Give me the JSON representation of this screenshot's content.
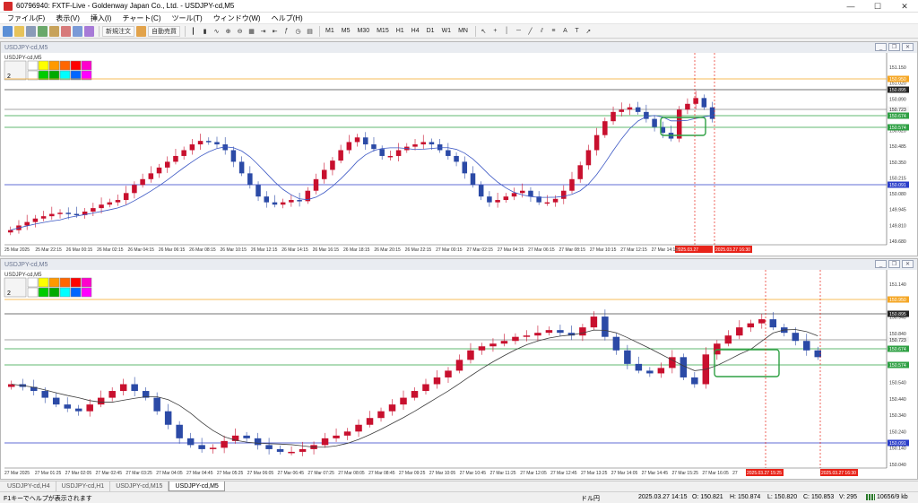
{
  "window": {
    "title": "60796940: FXTF-Live - Goldenway Japan Co., Ltd. - USDJPY-cd,M5"
  },
  "menu": [
    "ファイル(F)",
    "表示(V)",
    "挿入(I)",
    "チャート(C)",
    "ツール(T)",
    "ウィンドウ(W)",
    "ヘルプ(H)"
  ],
  "toolbar": {
    "new_order": "新規注文",
    "auto_trade": "自動売買",
    "timeframes": [
      "M1",
      "M5",
      "M30",
      "M15",
      "H1",
      "H4",
      "D1",
      "W1",
      "MN"
    ]
  },
  "colors": {
    "bull": "#c8102e",
    "bear": "#2b4aa6",
    "ma": "#3b57c4",
    "ma2": "#3c3c3c",
    "orange": "#f5a623",
    "green": "#2ea043",
    "blue_line": "#2b3ec9",
    "red_marker": "#e8241a"
  },
  "chart_top": {
    "title": "USDJPY-cd,M5",
    "subtitle": "USDJPY-cd,M5",
    "y_ticks": [
      "151.150",
      "151.020",
      "150.890",
      "150.755",
      "150.620",
      "150.485",
      "150.350",
      "150.215",
      "150.080",
      "149.945",
      "149.810",
      "149.680"
    ],
    "tags": [
      "150.950",
      "150.895",
      "150.723",
      "150.674",
      "150.574",
      "150.091"
    ],
    "x_ticks": [
      "25 Mar 2025",
      "25 Mar 22:15",
      "26 Mar 00:15",
      "26 Mar 02:15",
      "26 Mar 04:15",
      "26 Mar 06:15",
      "26 Mar 08:15",
      "26 Mar 10:15",
      "26 Mar 12:15",
      "26 Mar 14:15",
      "26 Mar 16:15",
      "26 Mar 18:15",
      "26 Mar 20:15",
      "26 Mar 22:15",
      "27 Mar 00:15",
      "27 Mar 02:15",
      "27 Mar 04:15",
      "27 Mar 06:15",
      "27 Mar 08:15",
      "27 Mar 10:15",
      "27 Mar 12:15",
      "27 Mar 14:15"
    ],
    "red_labels": [
      "2025.03.27 ",
      "2025.03.27 16:30"
    ],
    "closes": [
      149.86,
      149.9,
      149.93,
      149.96,
      149.98,
      150.0,
      150.01,
      150.0,
      149.99,
      150.02,
      150.05,
      150.08,
      150.1,
      150.12,
      150.18,
      150.25,
      150.3,
      150.35,
      150.4,
      150.45,
      150.5,
      150.55,
      150.6,
      150.63,
      150.62,
      150.6,
      150.55,
      150.45,
      150.35,
      150.25,
      150.15,
      150.1,
      150.08,
      150.1,
      150.12,
      150.11,
      150.2,
      150.3,
      150.38,
      150.46,
      150.55,
      150.62,
      150.66,
      150.6,
      150.56,
      150.5,
      150.5,
      150.55,
      150.58,
      150.6,
      150.62,
      150.6,
      150.55,
      150.5,
      150.45,
      150.35,
      150.25,
      150.15,
      150.1,
      150.12,
      150.15,
      150.18,
      150.2,
      150.15,
      150.1,
      150.1,
      150.13,
      150.2,
      150.3,
      150.42,
      150.55,
      150.68,
      150.8,
      150.88,
      150.9,
      150.92,
      150.88,
      150.82,
      150.75,
      150.7,
      150.65,
      150.9,
      150.95,
      151.0,
      150.92,
      150.82
    ]
  },
  "chart_bottom": {
    "title": "USDJPY-cd,M5",
    "subtitle": "USDJPY-cd,M5",
    "y_ticks": [
      "151.140",
      "151.040",
      "150.940",
      "150.840",
      "150.740",
      "150.640",
      "150.540",
      "150.440",
      "150.340",
      "150.240",
      "150.140",
      "150.040"
    ],
    "tags": [
      "150.950",
      "150.895",
      "150.723",
      "150.674",
      "150.574",
      "150.091"
    ],
    "x_ticks": [
      "27 Mar 2025",
      "27 Mar 01:25",
      "27 Mar 02:05",
      "27 Mar 02:45",
      "27 Mar 03:25",
      "27 Mar 04:05",
      "27 Mar 04:45",
      "27 Mar 05:25",
      "27 Mar 06:05",
      "27 Mar 06:45",
      "27 Mar 07:25",
      "27 Mar 08:05",
      "27 Mar 08:45",
      "27 Mar 09:25",
      "27 Mar 10:05",
      "27 Mar 10:45",
      "27 Mar 11:25",
      "27 Mar 12:05",
      "27 Mar 12:45",
      "27 Mar 13:25",
      "27 Mar 14:05",
      "27 Mar 14:45",
      "27 Mar 15:25",
      "27 Mar 16:05",
      "27"
    ],
    "red_labels": [
      "2025.03.27 15:25",
      "2025.03.27 16:30"
    ],
    "closes": [
      150.6,
      150.58,
      150.55,
      150.5,
      150.45,
      150.42,
      150.4,
      150.45,
      150.5,
      150.55,
      150.6,
      150.55,
      150.5,
      150.4,
      150.3,
      150.2,
      150.15,
      150.12,
      150.13,
      150.18,
      150.22,
      150.2,
      150.15,
      150.12,
      150.1,
      150.1,
      150.12,
      150.15,
      150.2,
      150.22,
      150.25,
      150.3,
      150.35,
      150.4,
      150.45,
      150.5,
      150.55,
      150.6,
      150.65,
      150.7,
      150.78,
      150.85,
      150.88,
      150.9,
      150.92,
      150.95,
      150.96,
      150.98,
      151.0,
      150.98,
      150.96,
      151.02,
      151.1,
      150.95,
      150.85,
      150.75,
      150.7,
      150.68,
      150.72,
      150.8,
      150.65,
      150.6,
      150.82,
      150.9,
      150.96,
      151.02,
      151.05,
      151.08,
      151.02,
      150.98,
      150.92,
      150.85,
      150.8
    ]
  },
  "tabs": [
    "USDJPY-cd,H4",
    "USDJPY-cd,H1",
    "USDJPY-cd,M15",
    "USDJPY-cd,M5"
  ],
  "status": {
    "help": "F1キーでヘルプが表示されます",
    "currency": "ドル円",
    "time": "2025.03.27 14:15",
    "open": "O: 150.821",
    "high": "H: 150.874",
    "low": "L: 150.820",
    "close": "C: 150.853",
    "volume": "V: 295",
    "traffic": "10656/9 kb"
  }
}
